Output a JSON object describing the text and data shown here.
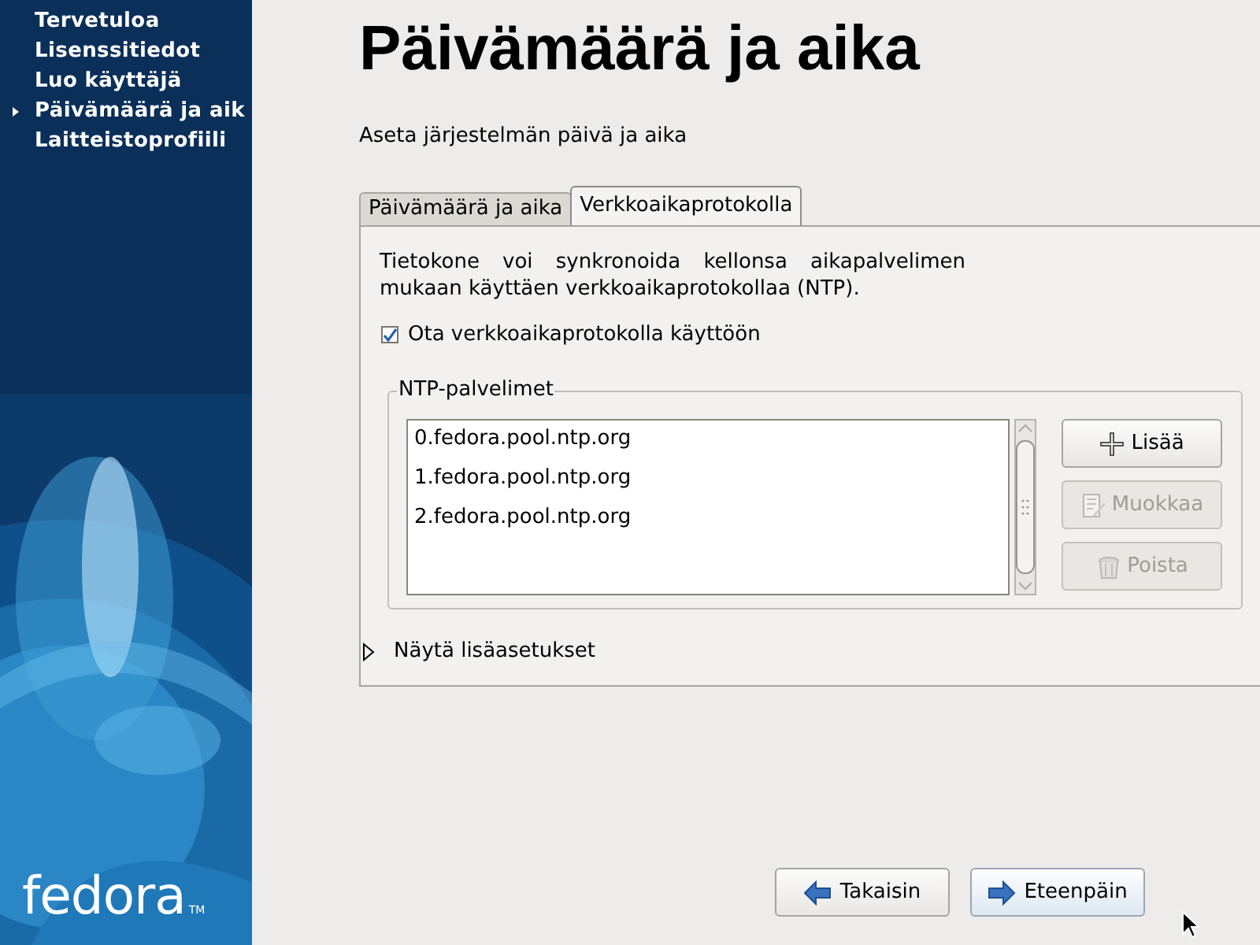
{
  "sidebar": {
    "items": [
      {
        "label": "Tervetuloa",
        "selected": false
      },
      {
        "label": "Lisenssitiedot",
        "selected": false
      },
      {
        "label": "Luo käyttäjä",
        "selected": false
      },
      {
        "label": "Päivämäärä ja aik",
        "selected": true
      },
      {
        "label": "Laitteistoprofiili",
        "selected": false
      }
    ],
    "logo": {
      "text": "fedora",
      "mark": "TM"
    }
  },
  "page": {
    "title": "Päivämäärä ja aika",
    "subtitle": "Aseta järjestelmän päivä ja aika"
  },
  "tabs": [
    {
      "label": "Päivämäärä ja aika",
      "selected": false
    },
    {
      "label": "Verkkoaikaprotokolla",
      "selected": true
    }
  ],
  "panel": {
    "description": "Tietokone voi synkronoida kellonsa aikapalvelimen mukaan käyttäen verkkoaikaprotokollaa (NTP).",
    "ntp_checkbox": {
      "label": "Ota verkkoaikaprotokolla käyttöön",
      "checked": true
    },
    "servers": {
      "title": "NTP-palvelimet",
      "rows": [
        "0.fedora.pool.ntp.org",
        "1.fedora.pool.ntp.org",
        "2.fedora.pool.ntp.org"
      ],
      "buttons": [
        {
          "kind": "add",
          "label": "Lisää",
          "disabled": false
        },
        {
          "kind": "edit",
          "label": "Muokkaa",
          "disabled": true
        },
        {
          "kind": "delete",
          "label": "Poista",
          "disabled": true
        }
      ]
    },
    "expander": {
      "label": "Näytä lisäasetukset",
      "expanded": false
    }
  },
  "footer": {
    "buttons": [
      {
        "kind": "back",
        "label": "Takaisin",
        "focused": false
      },
      {
        "kind": "forward",
        "label": "Eteenpäin",
        "focused": true
      }
    ]
  }
}
